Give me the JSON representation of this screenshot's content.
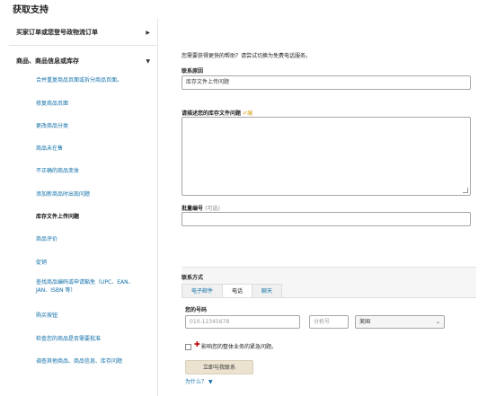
{
  "page": {
    "title": "获取支持"
  },
  "sidebar": {
    "section1": {
      "label": "买家订单或您登号政物流订单",
      "arrow": "▶"
    },
    "section2": {
      "label": "商品、商品信息或库存",
      "arrow": "▼"
    },
    "items": [
      {
        "label": "合并重复商品页面或拆分商品页面。"
      },
      {
        "label": "修复商品页面"
      },
      {
        "label": "更改商品分类"
      },
      {
        "label": "商品未在售"
      },
      {
        "label": "不正确的商品变体"
      },
      {
        "label": "添加新商品时出现问题"
      },
      {
        "label": "库存文件上传问题"
      },
      {
        "label": "商品评价"
      },
      {
        "label": "促销"
      },
      {
        "label": "查找商品编码或申请豁免（UPC、EAN、JAN、ISBN 等）"
      },
      {
        "label": "购买按钮"
      },
      {
        "label": "检查您的商品是否需要批准"
      },
      {
        "label": "调查其他商品、商品信息、库存问题"
      }
    ]
  },
  "form": {
    "intro": "您需要获得更快的帮助？请尝试切换为免费电话服务。",
    "reason_label": "联系原因",
    "reason_value": "库存文件上传问题",
    "describe_label": "请描述您的库存文件问题",
    "describe_edit": "✐编",
    "batch_label": "批量编号",
    "batch_optional": "(可选)",
    "contact_method_label": "联系方式",
    "tabs": [
      {
        "label": "电子邮件"
      },
      {
        "label": "电话"
      },
      {
        "label": "聊天"
      }
    ],
    "phone_label": "您的号码",
    "phone_placeholder": "010-12345678",
    "ext_placeholder": "分机号",
    "country_value": "美国",
    "urgent_text": "影响您的整体业务的紧急问题。",
    "call_button": "立即与我联系",
    "why_link": "为什么？",
    "why_chevron": "▼"
  }
}
